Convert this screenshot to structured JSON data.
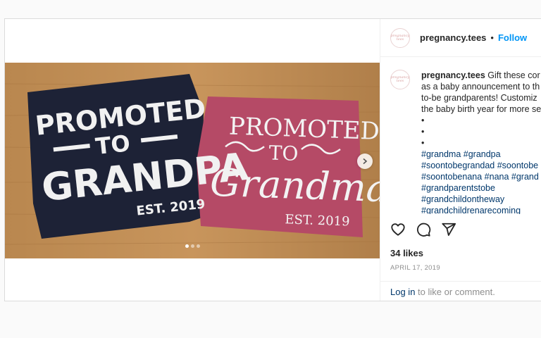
{
  "post": {
    "username": "pregnancy.tees",
    "separator": "•",
    "follow_label": "Follow",
    "avatar_text": "pregnancy tees",
    "caption": {
      "username": "pregnancy.tees",
      "lines": [
        "Gift these cor",
        "as a baby announcement to th",
        "to-be grandparents! Customiz",
        "the baby birth year for more se"
      ],
      "bullets": [
        "•",
        "•",
        "•"
      ],
      "hashtags": [
        "#grandma #grandpa",
        "#soontobegrandad #soontobe",
        "#soontobenana #nana #grand",
        "#grandparentstobe",
        "#grandchildontheway",
        "#grandchildrenarecoming"
      ]
    },
    "likes": "34 likes",
    "date": "APRIL 17, 2019",
    "login_link": "Log in",
    "login_suffix": " to like or comment."
  },
  "photo": {
    "left_shirt": {
      "line1": "PROMOTED",
      "line2": "TO",
      "line3": "GRANDPA",
      "line4": "EST. 2019",
      "color": "#1d2236"
    },
    "right_shirt": {
      "line1": "PROMOTED",
      "line2": "TO",
      "line3": "Grandma",
      "line4": "EST. 2019",
      "color": "#b54a66"
    },
    "carousel_count": 3,
    "carousel_active": 1
  },
  "icons": {
    "like": "heart-icon",
    "comment": "comment-icon",
    "share": "share-icon",
    "next": "chevron-right-icon"
  }
}
